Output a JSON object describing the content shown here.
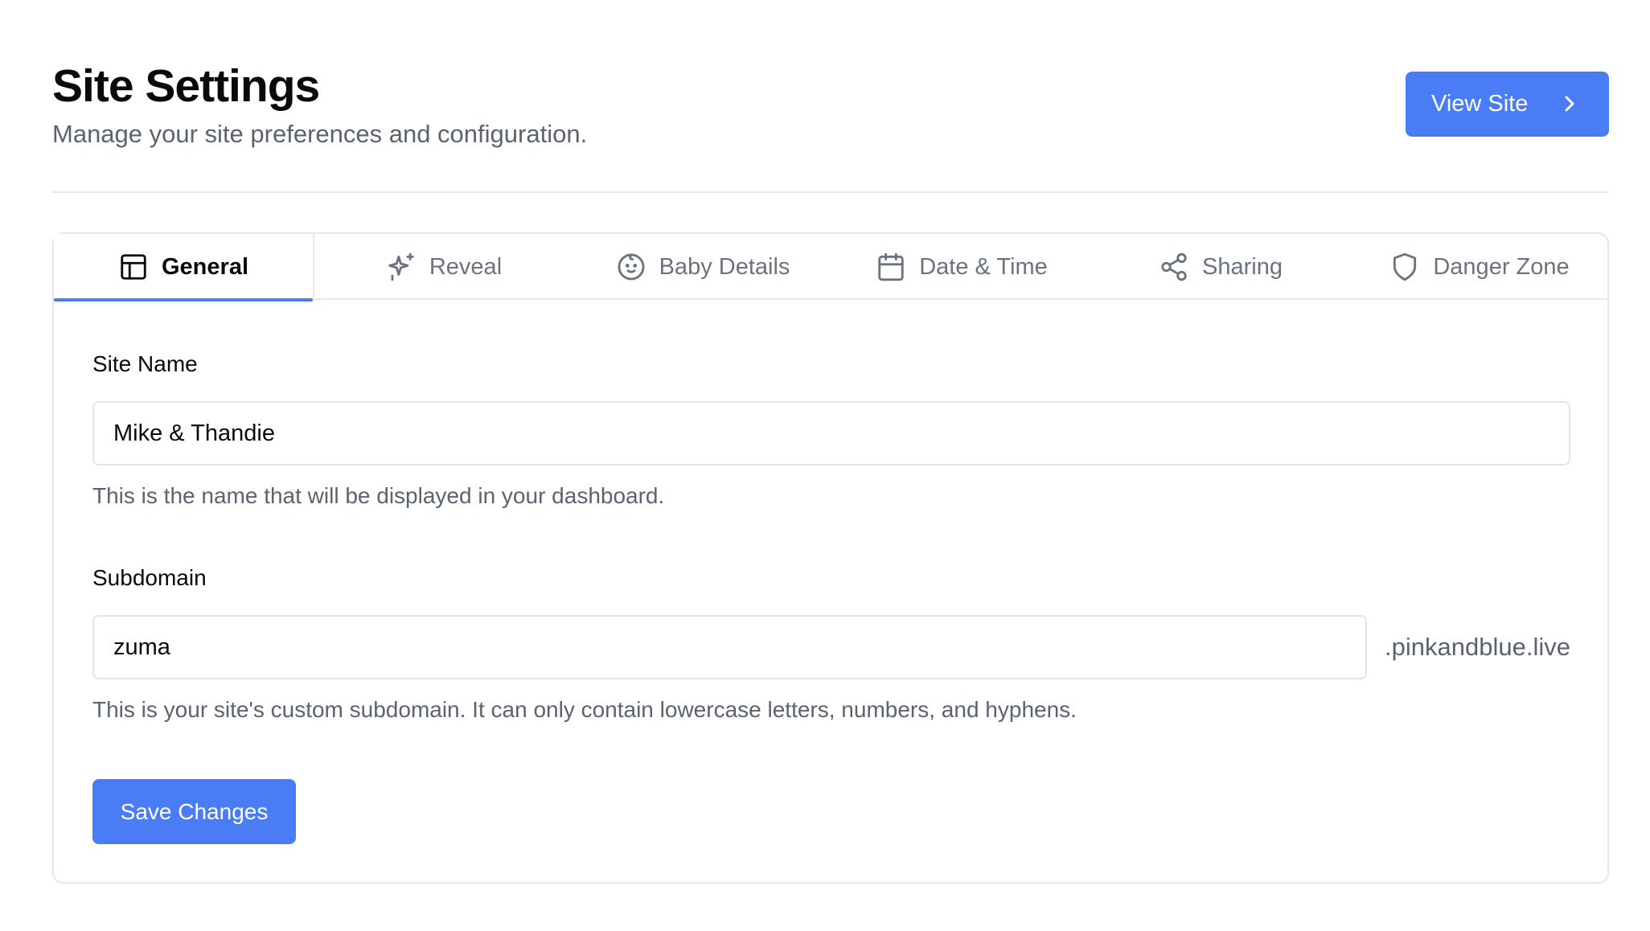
{
  "header": {
    "title": "Site Settings",
    "subtitle": "Manage your site preferences and configuration.",
    "view_site_label": "View Site"
  },
  "tabs": [
    {
      "label": "General",
      "icon": "layout-icon",
      "active": true
    },
    {
      "label": "Reveal",
      "icon": "sparkles-icon",
      "active": false
    },
    {
      "label": "Baby Details",
      "icon": "baby-icon",
      "active": false
    },
    {
      "label": "Date & Time",
      "icon": "calendar-icon",
      "active": false
    },
    {
      "label": "Sharing",
      "icon": "share-icon",
      "active": false
    },
    {
      "label": "Danger Zone",
      "icon": "shield-icon",
      "active": false
    }
  ],
  "form": {
    "site_name": {
      "label": "Site Name",
      "value": "Mike & Thandie",
      "help": "This is the name that will be displayed in your dashboard."
    },
    "subdomain": {
      "label": "Subdomain",
      "value": "zuma",
      "suffix": ".pinkandblue.live",
      "help": "This is your site's custom subdomain. It can only contain lowercase letters, numbers, and hyphens."
    },
    "save_label": "Save Changes"
  },
  "colors": {
    "accent": "#4a7cf5",
    "muted_text": "#5b6270",
    "border": "#e6e8eb"
  }
}
